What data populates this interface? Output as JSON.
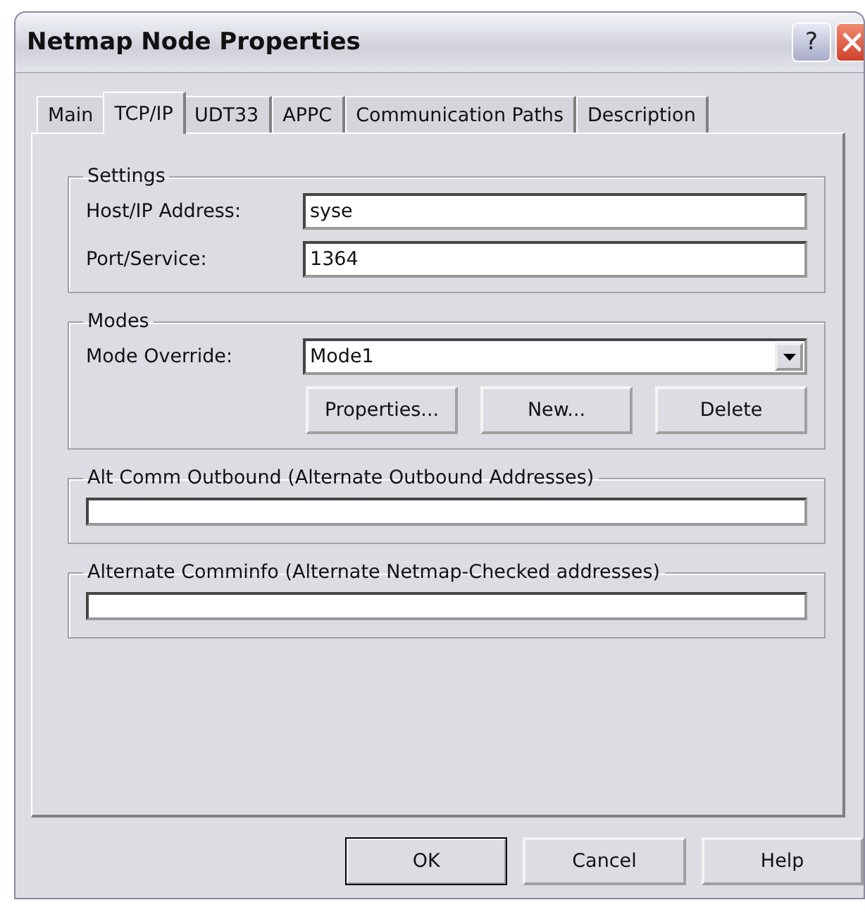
{
  "window": {
    "title": "Netmap Node Properties",
    "help_button": "?"
  },
  "tabs": [
    {
      "label": "Main",
      "selected": false
    },
    {
      "label": "TCP/IP",
      "selected": true
    },
    {
      "label": "UDT33",
      "selected": false
    },
    {
      "label": "APPC",
      "selected": false
    },
    {
      "label": "Communication Paths",
      "selected": false
    },
    {
      "label": "Description",
      "selected": false
    }
  ],
  "settings": {
    "title": "Settings",
    "fields": [
      {
        "label": "Host/IP Address:",
        "value": "syse"
      },
      {
        "label": "Port/Service:",
        "value": "1364"
      }
    ]
  },
  "modes": {
    "title": "Modes",
    "label": "Mode Override:",
    "value": "Mode1",
    "buttons": [
      "Properties...",
      "New...",
      "Delete"
    ]
  },
  "alt_comm_outbound": {
    "title": "Alt Comm Outbound  (Alternate Outbound Addresses)"
  },
  "alternate_comminfo": {
    "title": "Alternate Comminfo  (Alternate Netmap-Checked addresses)"
  },
  "buttons": [
    {
      "label": "OK",
      "default": true
    },
    {
      "label": "Cancel",
      "default": false
    },
    {
      "label": "Help",
      "default": false
    }
  ]
}
